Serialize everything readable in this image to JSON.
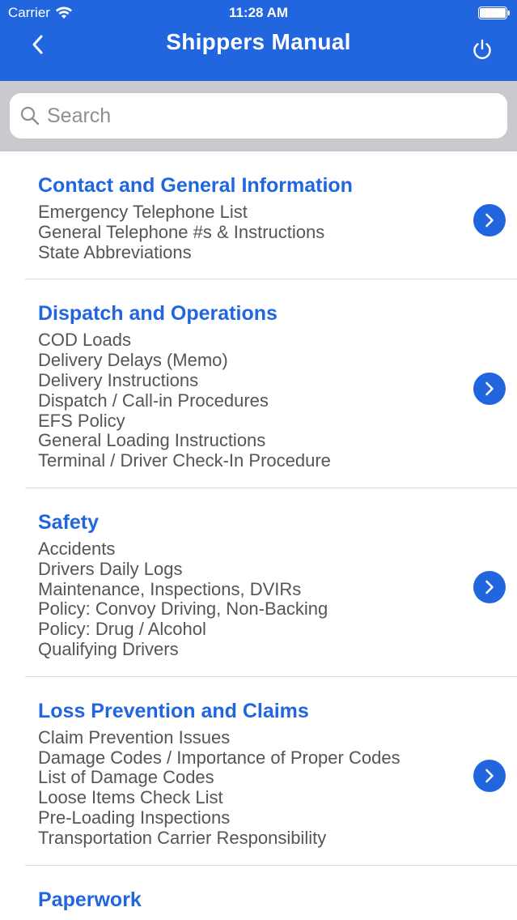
{
  "status_bar": {
    "carrier": "Carrier",
    "time": "11:28 AM"
  },
  "nav": {
    "title": "Shippers Manual"
  },
  "search": {
    "placeholder": "Search"
  },
  "colors": {
    "accent": "#2166df",
    "search_background": "#c9c9ce",
    "item_text": "#555555"
  },
  "sections": [
    {
      "title": "Contact and General Information",
      "items": [
        "Emergency Telephone List",
        "General Telephone #s & Instructions",
        "State Abbreviations"
      ]
    },
    {
      "title": "Dispatch and Operations",
      "items": [
        "COD Loads",
        "Delivery Delays (Memo)",
        "Delivery Instructions",
        "Dispatch / Call-in Procedures",
        "EFS Policy",
        "General Loading Instructions",
        "Terminal / Driver Check-In Procedure"
      ]
    },
    {
      "title": "Safety",
      "items": [
        "Accidents",
        "Drivers Daily Logs",
        "Maintenance, Inspections, DVIRs",
        "Policy:  Convoy Driving, Non-Backing",
        "Policy:  Drug / Alcohol",
        "Qualifying Drivers"
      ]
    },
    {
      "title": "Loss Prevention and Claims",
      "items": [
        "Claim Prevention Issues",
        "Damage Codes / Importance of Proper Codes",
        "List of Damage Codes",
        "Loose Items Check List",
        "Pre-Loading Inspections",
        "Transportation Carrier Responsibility"
      ]
    },
    {
      "title": "Paperwork",
      "items": []
    }
  ]
}
